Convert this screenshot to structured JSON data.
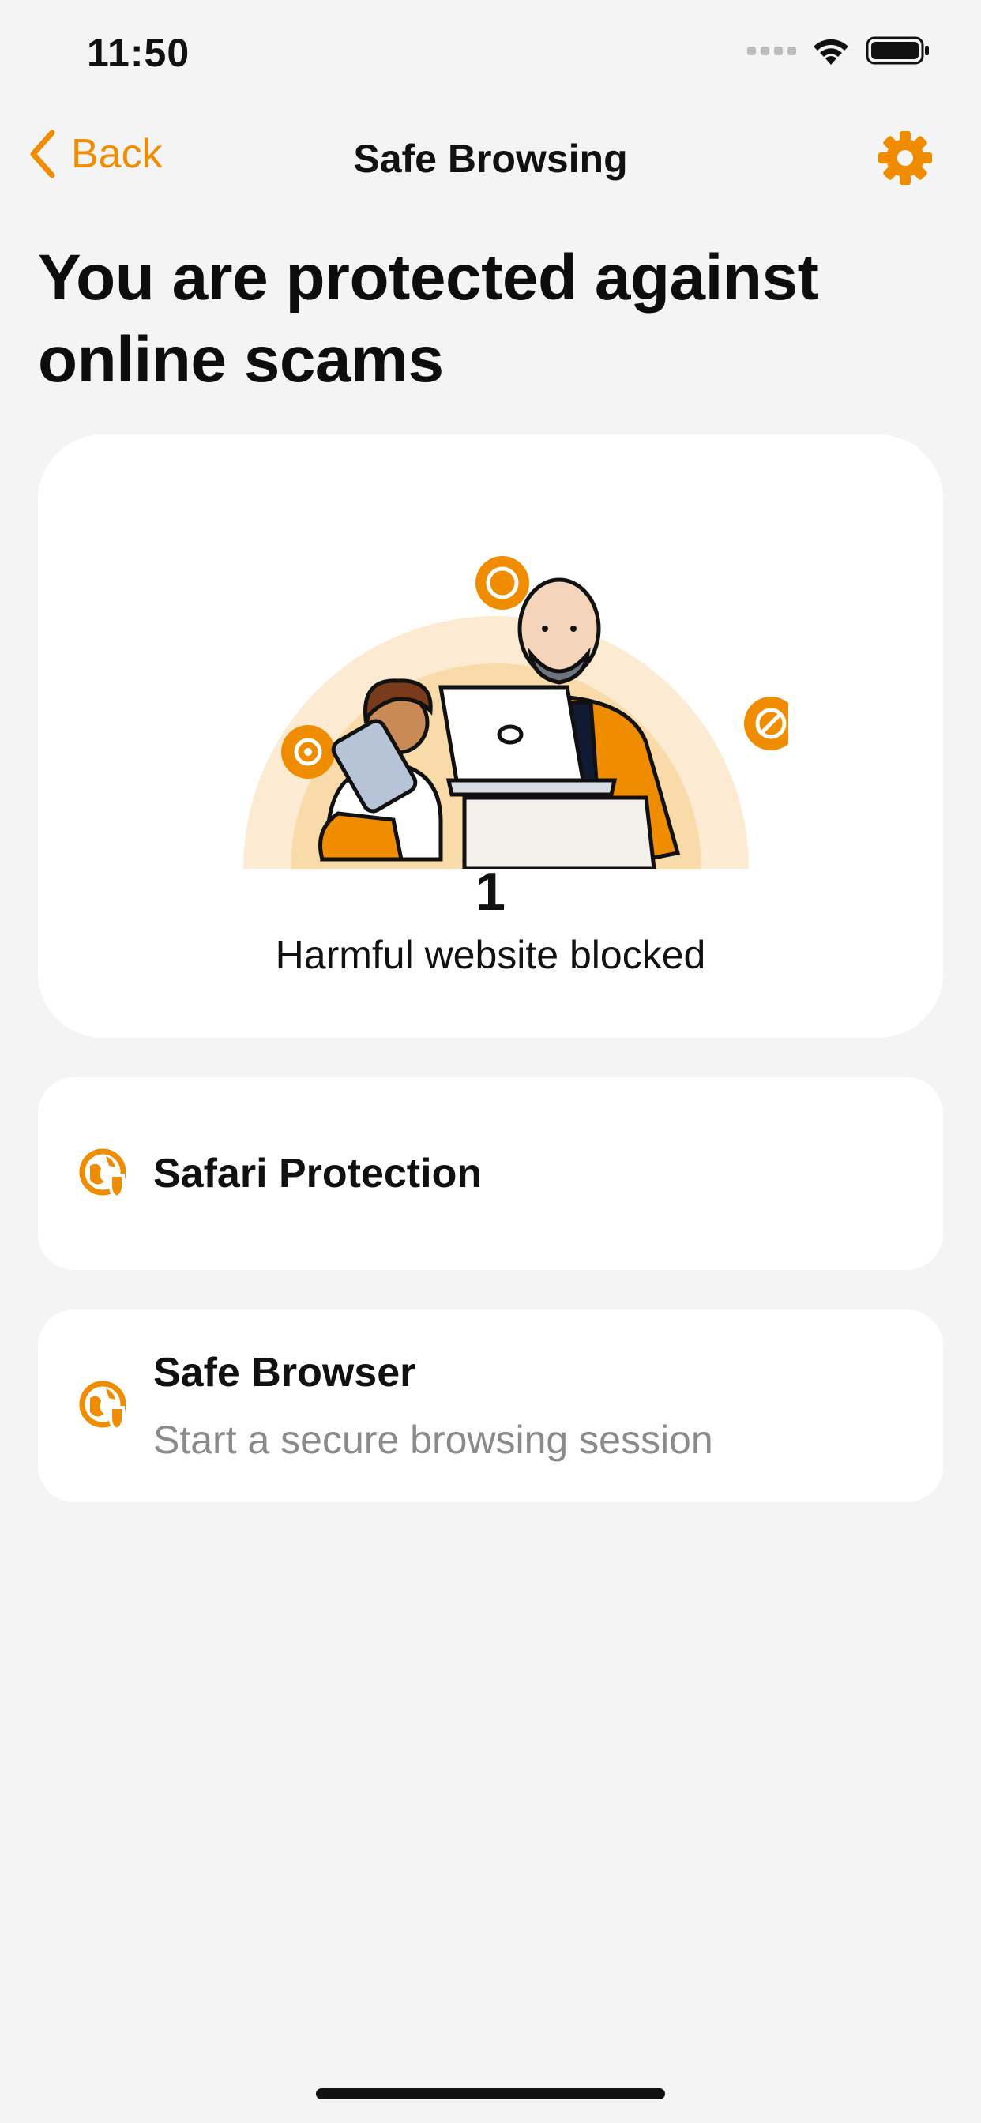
{
  "status_bar": {
    "time": "11:50"
  },
  "nav": {
    "back_label": "Back",
    "title": "Safe Browsing",
    "settings_icon": "gear-icon"
  },
  "heading": {
    "line1": "You are protected against",
    "line2": "online scams"
  },
  "hero": {
    "count": "1",
    "label": "Harmful website blocked"
  },
  "options": [
    {
      "icon": "globe-shield-icon",
      "title": "Safari Protection",
      "subtitle": ""
    },
    {
      "icon": "globe-shield-icon",
      "title": "Safe Browser",
      "subtitle": "Start a secure browsing session"
    }
  ],
  "colors": {
    "accent": "#F08C00",
    "background": "#F4F4F4",
    "card": "#FFFFFF",
    "subtitle": "#8A8A8A"
  }
}
